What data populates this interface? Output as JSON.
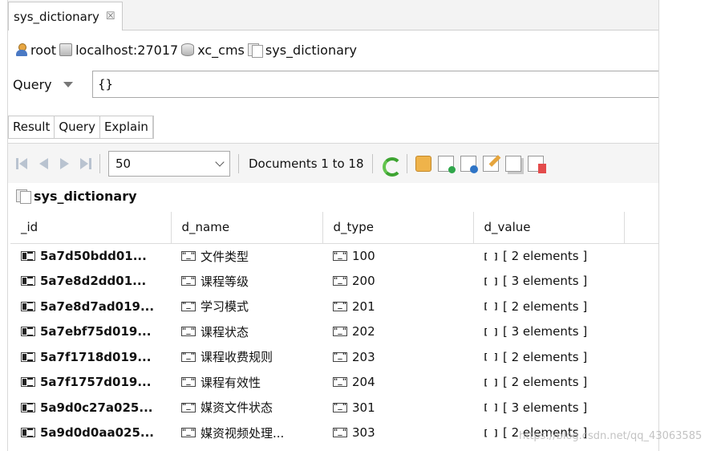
{
  "editor_tab": {
    "title": "sys_dictionary",
    "close_glyph": "☒"
  },
  "breadcrumb": [
    {
      "icon": "user-icon",
      "label": "root"
    },
    {
      "icon": "server-icon",
      "label": "localhost:27017"
    },
    {
      "icon": "database-icon",
      "label": "xc_cms"
    },
    {
      "icon": "collection-icon",
      "label": "sys_dictionary"
    }
  ],
  "query": {
    "label": "Query",
    "value": "{}"
  },
  "result_tabs": [
    "Result",
    "Query",
    "Explain"
  ],
  "toolbar": {
    "page_size": "50",
    "documents_label": "Documents 1 to 18"
  },
  "collection_title": "sys_dictionary",
  "table": {
    "columns": [
      "_id",
      "d_name",
      "d_type",
      "d_value"
    ],
    "rows": [
      {
        "id": "5a7d50bdd01...",
        "name": "文件类型",
        "type": "100",
        "value": "[ 2 elements ]"
      },
      {
        "id": "5a7e8d2dd01...",
        "name": "课程等级",
        "type": "200",
        "value": "[ 3 elements ]"
      },
      {
        "id": "5a7e8d7ad019...",
        "name": "学习模式",
        "type": "201",
        "value": "[ 2 elements ]"
      },
      {
        "id": "5a7ebf75d019...",
        "name": "课程状态",
        "type": "202",
        "value": "[ 3 elements ]"
      },
      {
        "id": "5a7f1718d019...",
        "name": "课程收费规则",
        "type": "203",
        "value": "[ 2 elements ]"
      },
      {
        "id": "5a7f1757d019...",
        "name": "课程有效性",
        "type": "204",
        "value": "[ 2 elements ]"
      },
      {
        "id": "5a9d0c27a025...",
        "name": "媒资文件状态",
        "type": "301",
        "value": "[ 3 elements ]"
      },
      {
        "id": "5a9d0d0aa025...",
        "name": "媒资视频处理...",
        "type": "303",
        "value": "[ 2 elements ]"
      }
    ]
  },
  "watermark": "https://blog.csdn.net/qq_43063585"
}
